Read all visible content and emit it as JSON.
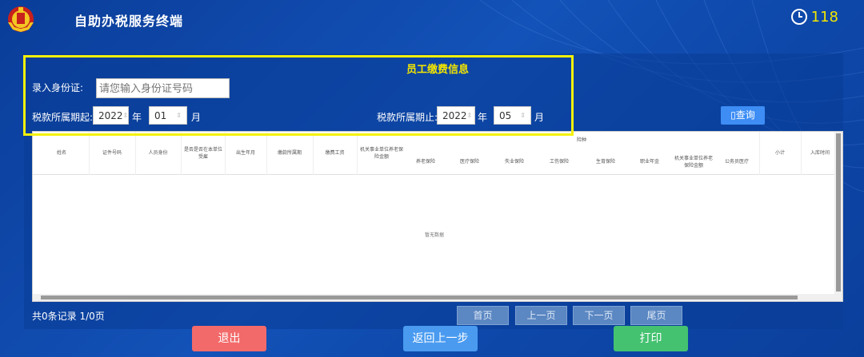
{
  "header": {
    "title": "自助办税服务终端",
    "timer": "118"
  },
  "form": {
    "section_title": "员工缴费信息",
    "id_label": "录入身份证:",
    "id_placeholder": "请您输入身份证号码",
    "start_label": "税款所属期起:",
    "start_year": "2022",
    "start_month": "01",
    "end_label": "税款所属期止:",
    "end_year": "2022",
    "end_month": "05",
    "year_unit": "年",
    "month_unit": "月",
    "query_label": "查询"
  },
  "table": {
    "headers": [
      "姓名",
      "证件号码",
      "人员身份",
      "是否是否在本单位受雇",
      "出生年月",
      "缴款所属期",
      "缴费工资",
      "机关事业单位养老保险金额",
      "小计",
      "入库时间"
    ],
    "group_header": "险种",
    "sub_headers": [
      "养老保险",
      "医疗保险",
      "失业保险",
      "工伤保险",
      "生育保险",
      "职业年金",
      "机关事业单位养老保险金额",
      "公务员医疗"
    ],
    "empty_text": "暂无数据"
  },
  "pagination": {
    "record_info": "共0条记录  1/0页",
    "first": "首页",
    "prev": "上一页",
    "next": "下一页",
    "last": "尾页"
  },
  "actions": {
    "exit": "退出",
    "back": "返回上一步",
    "print": "打印"
  }
}
